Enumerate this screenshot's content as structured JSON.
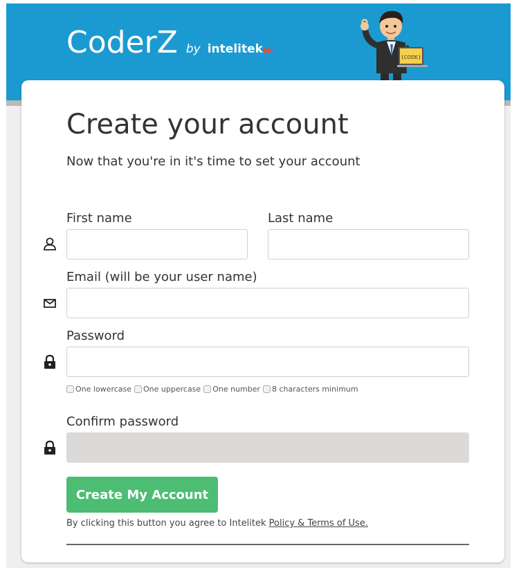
{
  "brand": {
    "name": "CoderZ",
    "by": "by",
    "partner": "intelitek",
    "arrows": "▶▶",
    "colors": {
      "header": "#1b9ad2",
      "button": "#4dbd74",
      "partner_arrow": "#e84a3a"
    }
  },
  "mascot": {
    "icon": "coder-mascot",
    "sign_text": "{CODE}"
  },
  "form": {
    "title": "Create your account",
    "subtitle": "Now that you're in it's time to set your account",
    "first_name": {
      "label": "First name",
      "value": "",
      "placeholder": "",
      "icon": "user-icon"
    },
    "last_name": {
      "label": "Last name",
      "value": "",
      "placeholder": ""
    },
    "email": {
      "label": "Email (will be your user name)",
      "value": "",
      "placeholder": "",
      "icon": "envelope-icon"
    },
    "password": {
      "label": "Password",
      "value": "",
      "placeholder": "",
      "icon": "lock-icon"
    },
    "requirements": [
      {
        "label": "One lowercase",
        "checked": false
      },
      {
        "label": "One uppercase",
        "checked": false
      },
      {
        "label": "One number",
        "checked": false
      },
      {
        "label": "8 characters minimum",
        "checked": false
      }
    ],
    "confirm_password": {
      "label": "Confirm password",
      "value": "",
      "placeholder": "",
      "icon": "lock-icon",
      "disabled": true
    },
    "submit_label": "Create My Account",
    "terms_text": "By clicking this button you agree to Intelitek ",
    "terms_link": "Policy & Terms of Use."
  }
}
